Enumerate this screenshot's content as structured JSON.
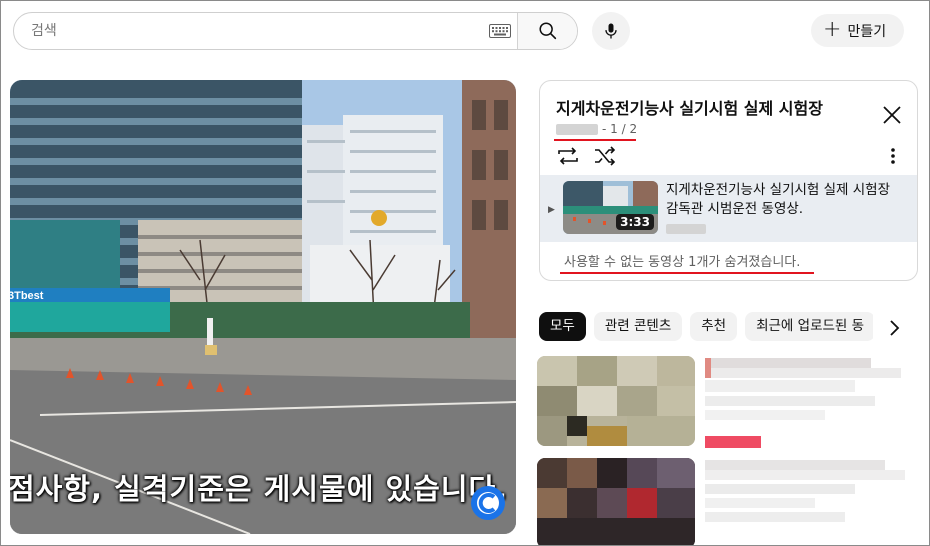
{
  "search": {
    "placeholder": "검색"
  },
  "header": {
    "create_label": "만들기"
  },
  "player": {
    "caption": "점사항, 실격기준은 게시물에 있습니다.",
    "sign_text": "3Tbest"
  },
  "playlist": {
    "title": "지게차운전기능사 실기시험 실제 시험장",
    "position": "- 1 / 2",
    "item": {
      "title": "지게차운전기능사 실기시험 실제 시험장 감독관 시범운전 동영상.",
      "duration": "3:33"
    },
    "hidden_note": "사용할 수 없는 동영상 1개가 숨겨졌습니다."
  },
  "chips": [
    "모두",
    "관련 콘텐츠",
    "추천",
    "최근에 업로드된 동"
  ],
  "colors": {
    "annotation_red": "#e1141f",
    "chip_active": "#0f0f0f",
    "accent_blue": "#1a73e8"
  },
  "icons": {
    "keyboard": "keyboard-icon",
    "search": "search-icon",
    "mic": "mic-icon",
    "create": "plus-icon",
    "close": "close-icon",
    "loop": "loop-icon",
    "shuffle": "shuffle-icon",
    "more": "more-vert-icon",
    "next": "chevron-right-icon"
  }
}
